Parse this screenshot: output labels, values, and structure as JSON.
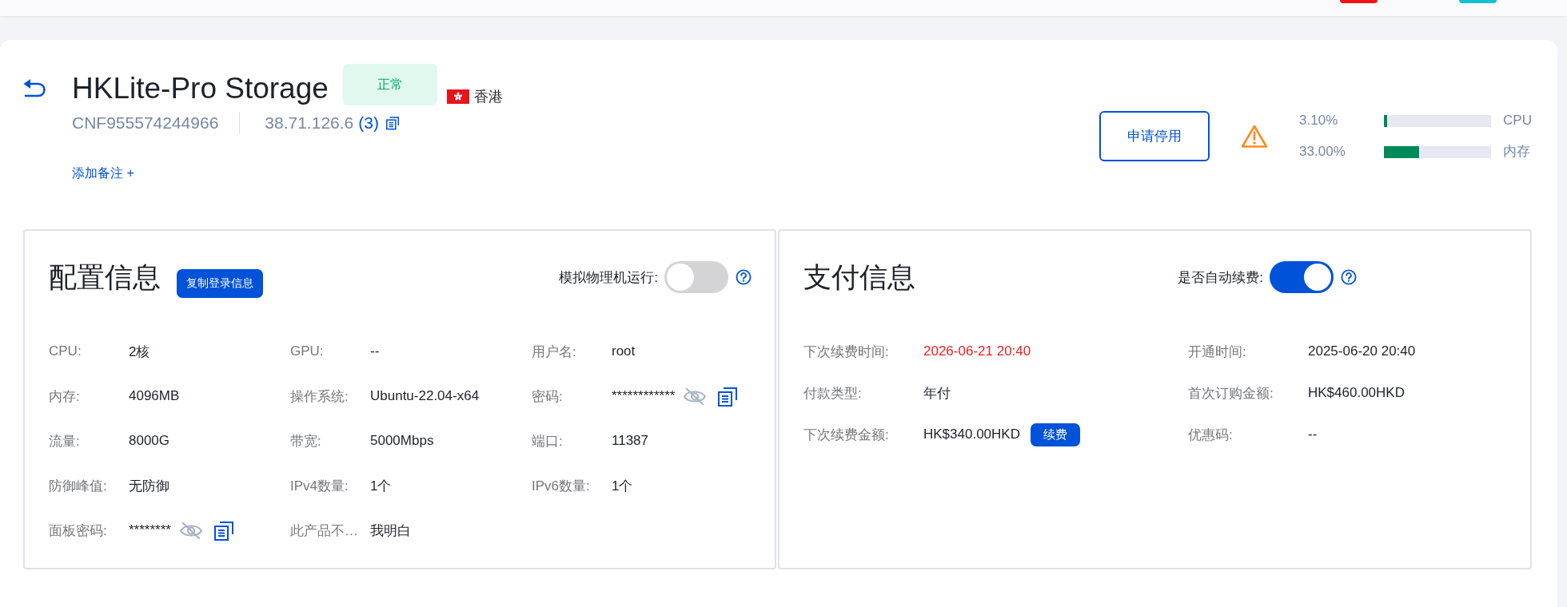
{
  "top_bar": {
    "tiles": [
      {
        "color": "#f01414"
      },
      {
        "color": "#12bfd6"
      }
    ]
  },
  "header": {
    "title": "HKLite-Pro Storage",
    "status": "正常",
    "region": "香港",
    "instance_id": "CNF955574244966",
    "ip": "38.71.126.6",
    "ip_count": "(3)",
    "add_note": "添加备注 +",
    "disable_button": "申请停用"
  },
  "usage": [
    {
      "reading": "3.10%",
      "level": 0.031,
      "label": "CPU"
    },
    {
      "reading": "33.00%",
      "level": 0.33,
      "label": "内存"
    }
  ],
  "config": {
    "title": "配置信息",
    "copy_button": "复制登录信息",
    "toggle": {
      "label": "模拟物理机运行:",
      "on": false
    },
    "fields": [
      {
        "kind": "text",
        "label": "CPU:",
        "value": "2核"
      },
      {
        "kind": "text",
        "label": "GPU:",
        "value": "--"
      },
      {
        "kind": "text",
        "label": "用户名:",
        "value": "root"
      },
      {
        "kind": "text",
        "label": "内存:",
        "value": "4096MB"
      },
      {
        "kind": "text",
        "label": "操作系统:",
        "value": "Ubuntu-22.04-x64"
      },
      {
        "kind": "secret",
        "label": "密码:",
        "value": "************"
      },
      {
        "kind": "text",
        "label": "流量:",
        "value": "8000G"
      },
      {
        "kind": "text",
        "label": "带宽:",
        "value": "5000Mbps"
      },
      {
        "kind": "text",
        "label": "端口:",
        "value": "11387"
      },
      {
        "kind": "text",
        "label": "防御峰值:",
        "value": "无防御"
      },
      {
        "kind": "text",
        "label": "IPv4数量:",
        "value": "1个"
      },
      {
        "kind": "text",
        "label": "IPv6数量:",
        "value": "1个"
      },
      {
        "kind": "secret",
        "label": "面板密码:",
        "value": "********"
      },
      {
        "kind": "text",
        "label": "此产品不…",
        "value": "我明白"
      }
    ]
  },
  "payment": {
    "title": "支付信息",
    "toggle": {
      "label": "是否自动续费:",
      "on": true
    },
    "fields": [
      {
        "kind": "alert",
        "label": "下次续费时间:",
        "value": "2026-06-21 20:40"
      },
      {
        "kind": "text",
        "label": "开通时间:",
        "value": "2025-06-20 20:40"
      },
      {
        "kind": "text",
        "label": "付款类型:",
        "value": "年付"
      },
      {
        "kind": "text",
        "label": "首次订购金额:",
        "value": "HK$460.00HKD"
      },
      {
        "kind": "action",
        "label": "下次续费金额:",
        "value": "HK$340.00HKD",
        "button": "续费"
      },
      {
        "kind": "text",
        "label": "优惠码:",
        "value": "--"
      }
    ]
  }
}
